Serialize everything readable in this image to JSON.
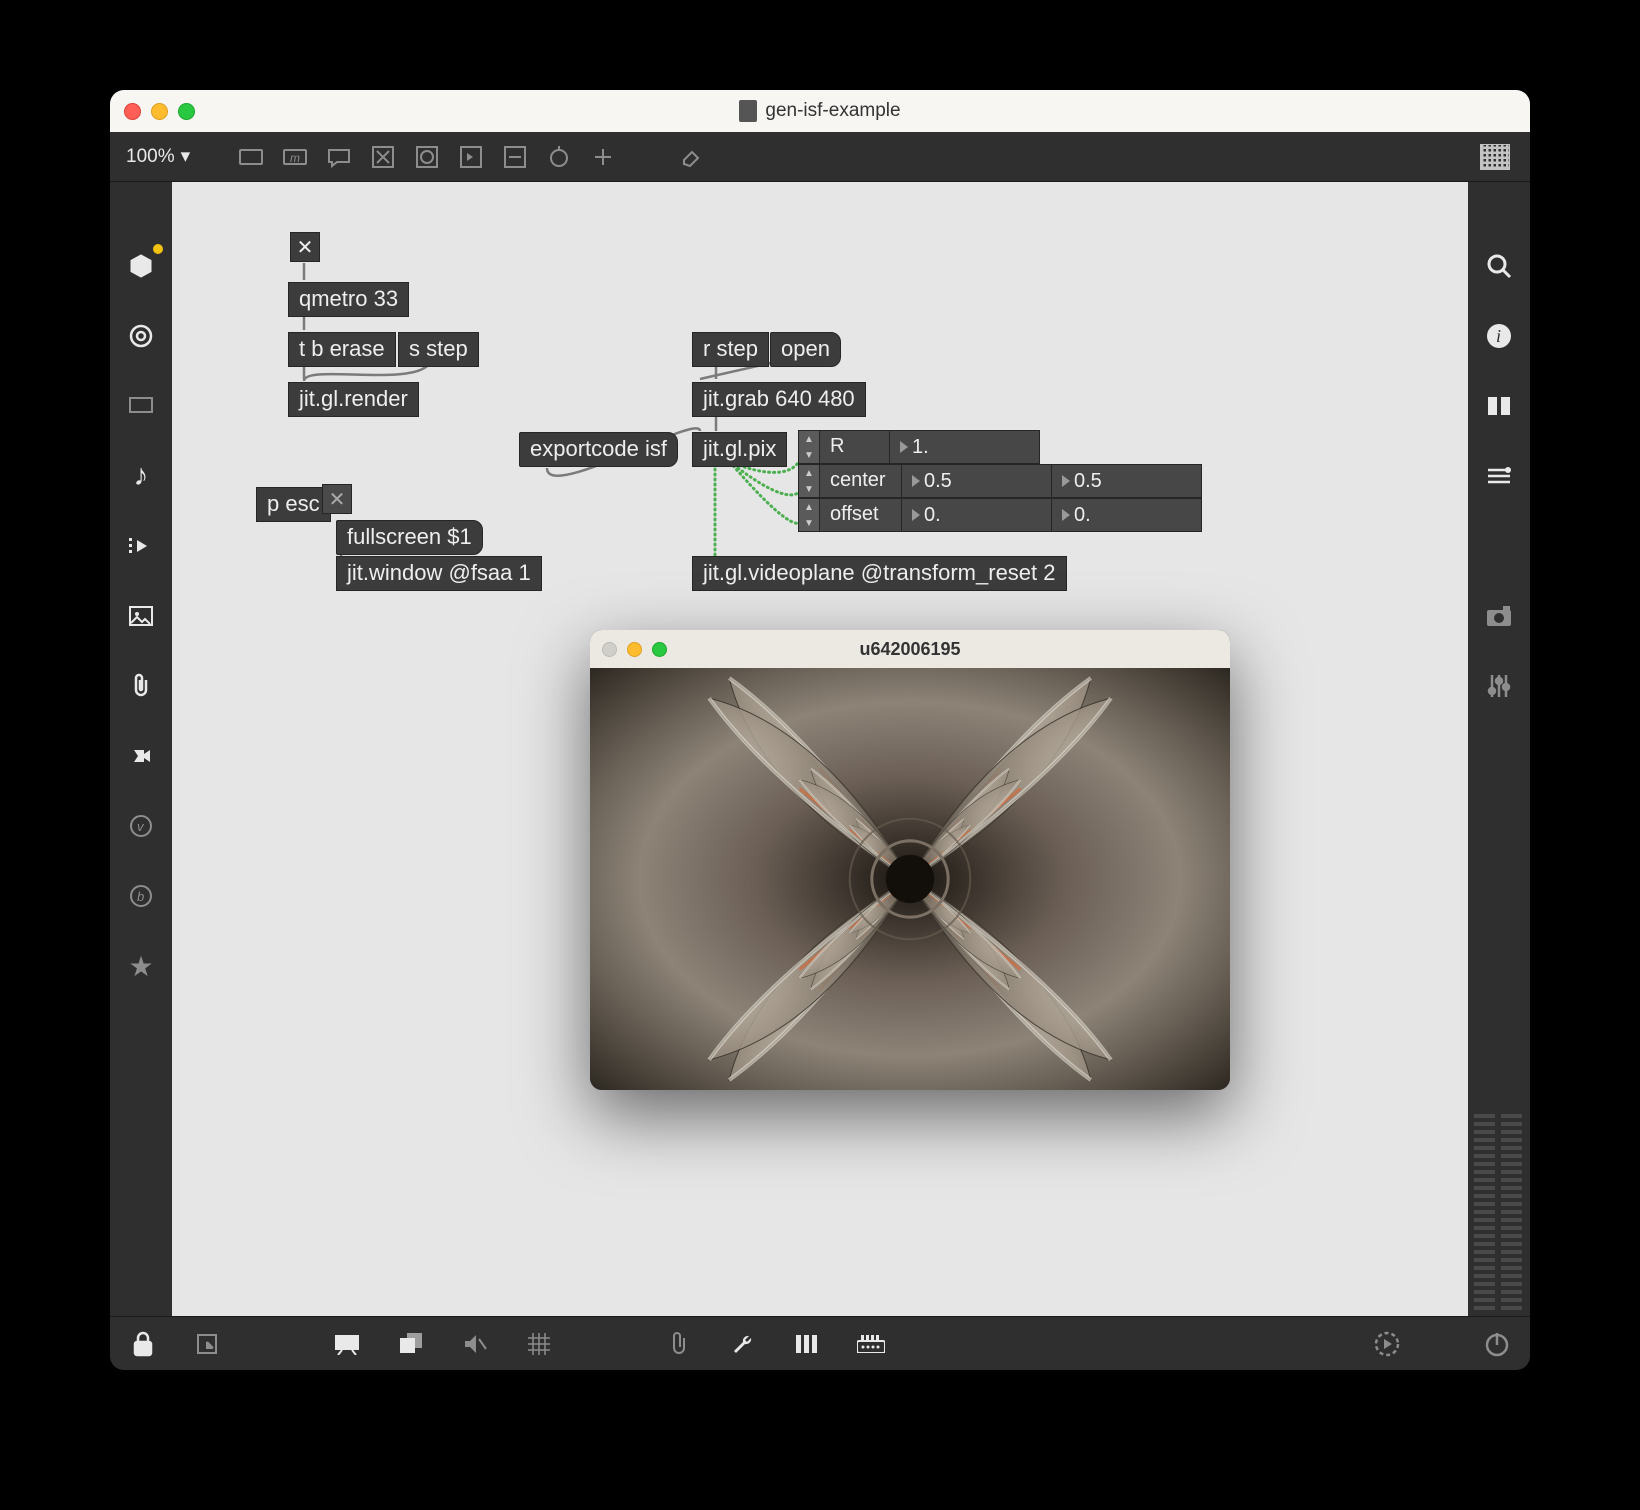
{
  "window": {
    "title": "gen-isf-example"
  },
  "toolbar": {
    "zoom_label": "100%"
  },
  "patch": {
    "toggle1": "✕",
    "qmetro": "qmetro 33",
    "trigger": "t b erase",
    "trigger2": "s step",
    "render": "jit.gl.render",
    "rstep": "r step",
    "open": "open",
    "grab": "jit.grab 640 480",
    "exportcode": "exportcode isf",
    "glpix": "jit.gl.pix",
    "pesc": "p esc",
    "fullscreen": "fullscreen $1",
    "jitwindow": "jit.window @fsaa 1",
    "videoplane": "jit.gl.videoplane @transform_reset 2",
    "attr_R": {
      "name": "R",
      "val": "1."
    },
    "attr_center": {
      "name": "center",
      "v1": "0.5",
      "v2": "0.5"
    },
    "attr_offset": {
      "name": "offset",
      "v1": "0.",
      "v2": "0."
    }
  },
  "jitter_window": {
    "title": "u642006195"
  }
}
